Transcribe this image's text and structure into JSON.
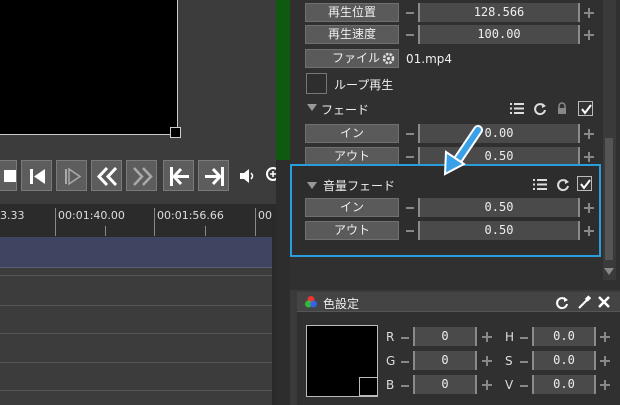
{
  "transport": {
    "icons": [
      "stop-icon",
      "step-back-icon",
      "step-forward-icon",
      "rewind-icon",
      "fast-forward-icon",
      "go-start-icon",
      "go-end-icon",
      "volume-icon",
      "zoom-in-icon"
    ]
  },
  "timeline": {
    "ruler_labels": [
      "3.33",
      "00:01:40.00",
      "00:01:56.66",
      "00"
    ]
  },
  "playback": {
    "position_label": "再生位置",
    "position_value": "128.566",
    "speed_label": "再生速度",
    "speed_value": "100.00",
    "file_label": "ファイル",
    "file_name": "01.mp4",
    "loop_label": "ループ再生",
    "loop_checked": false
  },
  "fade": {
    "title": "フェード",
    "in_label": "イン",
    "in_value": "0.00",
    "out_label": "アウト",
    "out_value": "0.50",
    "enabled": true
  },
  "audio_fade": {
    "title": "音量フェード",
    "in_label": "イン",
    "in_value": "0.50",
    "out_label": "アウト",
    "out_value": "0.50",
    "enabled": true
  },
  "color_settings": {
    "title": "色設定",
    "r_label": "R",
    "r_value": "0",
    "g_label": "G",
    "g_value": "0",
    "b_label": "B",
    "b_value": "0",
    "h_label": "H",
    "h_value": "0.0",
    "s_label": "S",
    "s_value": "0.0",
    "v_label": "V",
    "v_value": "0.0"
  },
  "colors": {
    "accent_highlight": "#2a9ddd",
    "arrow_blue": "#3aa0e8",
    "track_selected": "#3f4460",
    "green_strip": "#0f5a10"
  }
}
